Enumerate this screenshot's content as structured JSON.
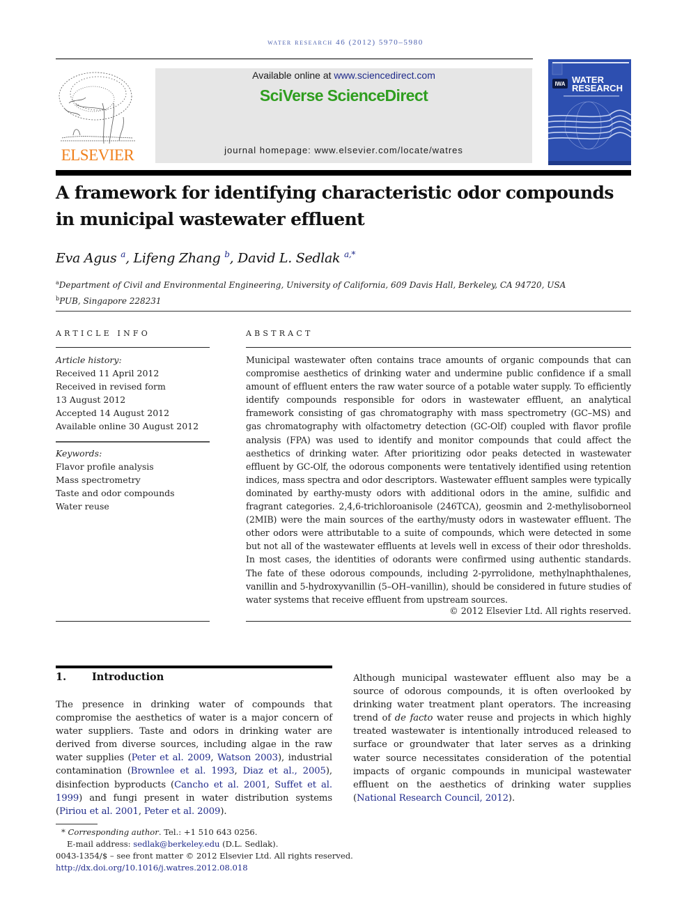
{
  "header": {
    "journal_citation": "WATER RESEARCH 46 (2012) 5970–5980",
    "publisher_logo_text": "ELSEVIER",
    "available_online_prefix": "Available online at ",
    "available_online_link": "www.sciencedirect.com",
    "platform_brand": "SciVerse ScienceDirect",
    "journal_homepage": "journal homepage: www.elsevier.com/locate/watres",
    "cover": {
      "badge": "IWA",
      "title_line1": "WATER",
      "title_line2": "RESEARCH"
    },
    "colors": {
      "elsevier_orange": "#f0801c",
      "sciencedirect_green": "#2f9e1f",
      "cover_blue": "#2d4fb0",
      "link_blue": "#1f2a8a"
    }
  },
  "article": {
    "title": "A framework for identifying characteristic odor compounds in municipal wastewater effluent",
    "authors": [
      {
        "name": "Eva Agus",
        "affil": "a"
      },
      {
        "name": "Lifeng Zhang",
        "affil": "b"
      },
      {
        "name": "David L. Sedlak",
        "affil": "a,*"
      }
    ],
    "affiliations": [
      {
        "mark": "a",
        "text": "Department of Civil and Environmental Engineering, University of California, 609 Davis Hall, Berkeley, CA 94720, USA"
      },
      {
        "mark": "b",
        "text": "PUB, Singapore 228231"
      }
    ]
  },
  "article_info": {
    "heading": "ARTICLE INFO",
    "history_label": "Article history:",
    "history": [
      "Received 11 April 2012",
      "Received in revised form",
      "13 August 2012",
      "Accepted 14 August 2012",
      "Available online 30 August 2012"
    ],
    "keywords_label": "Keywords:",
    "keywords": [
      "Flavor profile analysis",
      "Mass spectrometry",
      "Taste and odor compounds",
      "Water reuse"
    ]
  },
  "abstract": {
    "heading": "ABSTRACT",
    "text": "Municipal wastewater often contains trace amounts of organic compounds that can compromise aesthetics of drinking water and undermine public confidence if a small amount of effluent enters the raw water source of a potable water supply. To efficiently identify compounds responsible for odors in wastewater effluent, an analytical framework consisting of gas chromatography with mass spectrometry (GC–MS) and gas chromatography with olfactometry detection (GC-Olf) coupled with flavor profile analysis (FPA) was used to identify and monitor compounds that could affect the aesthetics of drinking water. After prioritizing odor peaks detected in wastewater effluent by GC-Olf, the odorous components were tentatively identified using retention indices, mass spectra and odor descriptors. Wastewater effluent samples were typically dominated by earthy-musty odors with additional odors in the amine, sulfidic and fragrant categories. 2,4,6-trichloroanisole (246TCA), geosmin and 2-methylisoborneol (2MIB) were the main sources of the earthy/musty odors in wastewater effluent. The other odors were attributable to a suite of compounds, which were detected in some but not all of the wastewater effluents at levels well in excess of their odor thresholds. In most cases, the identities of odorants were confirmed using authentic standards. The fate of these odorous compounds, including 2-pyrrolidone, methylnaphthalenes, vanillin and 5-hydroxyvanillin (5–OH–vanillin), should be considered in future studies of water systems that receive effluent from upstream sources.",
    "copyright": "© 2012 Elsevier Ltd. All rights reserved."
  },
  "introduction": {
    "number": "1.",
    "heading": "Introduction",
    "p1": [
      {
        "t": "The presence in drinking water of compounds that compromise the aesthetics of water is a major concern of water suppliers. Taste and odors in drinking water are derived from diverse sources, including algae in the raw water supplies ("
      },
      {
        "t": "Peter et al. 2009",
        "link": true
      },
      {
        "t": ", "
      },
      {
        "t": "Watson 2003",
        "link": true
      },
      {
        "t": "), industrial contamination ("
      },
      {
        "t": "Brownlee et al. 1993",
        "link": true
      },
      {
        "t": ", "
      },
      {
        "t": "Diaz et al., 2005",
        "link": true
      },
      {
        "t": "), disinfection byproducts ("
      },
      {
        "t": "Cancho et al. 2001",
        "link": true
      },
      {
        "t": ", "
      },
      {
        "t": "Suffet et al. 1999",
        "link": true
      },
      {
        "t": ") and fungi present in water distribution systems ("
      },
      {
        "t": "Piriou et al. 2001",
        "link": true
      },
      {
        "t": ", "
      },
      {
        "t": "Peter et al. 2009",
        "link": true
      },
      {
        "t": ")."
      }
    ],
    "p2": [
      {
        "t": "Although municipal wastewater effluent also may be a source of odorous compounds, it is often overlooked by drinking water treatment plant operators. The increasing trend of "
      },
      {
        "t": "de facto",
        "italic": true
      },
      {
        "t": " water reuse and projects in which highly treated wastewater is intentionally introduced released to surface or groundwater that later serves as a drinking water source necessitates consideration of the potential impacts of organic compounds in municipal wastewater effluent on the aesthetics of drinking water supplies ("
      },
      {
        "t": "National Research Council, 2012",
        "link": true
      },
      {
        "t": ")."
      }
    ]
  },
  "footnotes": {
    "corresponding_mark": "*",
    "corresponding_label": "Corresponding author",
    "corresponding_tel": ". Tel.: +1 510 643 0256.",
    "email_label": "E-mail address: ",
    "email": "sedlak@berkeley.edu",
    "email_suffix": " (D.L. Sedlak).",
    "front_matter": "0043-1354/$ – see front matter © 2012 Elsevier Ltd. All rights reserved.",
    "doi": "http://dx.doi.org/10.1016/j.watres.2012.08.018"
  }
}
